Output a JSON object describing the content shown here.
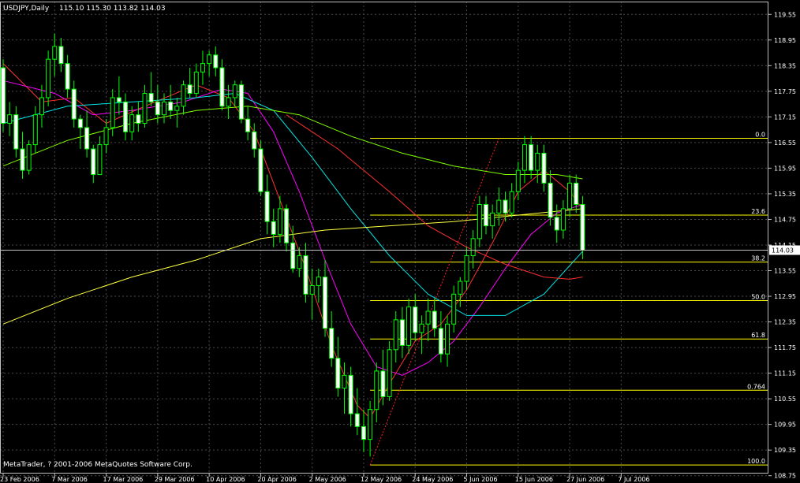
{
  "window": {
    "title": "USDJPY,Daily",
    "ohlc": "115.10 115.30 113.82 114.03"
  },
  "footer": {
    "copyright": "MetaTrader, ? 2001-2006 MetaQuotes Software Corp."
  },
  "colors": {
    "background": "#000000",
    "grid": "#4a4a4a",
    "axis": "#c0c0c0",
    "bull": "#00ff00",
    "bear_body": "#ffffff",
    "bear_outline": "#00ff00",
    "fib": "#ffff00",
    "bid_line": "#c0c0c0",
    "ma_red": "#ff3030",
    "ma_magenta": "#ff00ff",
    "ma_cyan": "#00e5e5",
    "ma_green": "#80ff00",
    "ma_yellow": "#ffff40"
  },
  "chart_data": {
    "type": "candlestick",
    "symbol": "USDJPY",
    "timeframe": "Daily",
    "y_range": [
      108.8,
      119.85
    ],
    "y_ticks": [
      "119.55",
      "118.95",
      "118.35",
      "117.75",
      "117.15",
      "116.55",
      "115.95",
      "115.35",
      "114.75",
      "114.15",
      "113.55",
      "112.95",
      "112.35",
      "111.75",
      "111.15",
      "110.55",
      "109.95",
      "109.35",
      "108.75"
    ],
    "x_labels": [
      {
        "label": "23 Feb 2006",
        "index": 0
      },
      {
        "label": "7 Mar 2006",
        "index": 8
      },
      {
        "label": "17 Mar 2006",
        "index": 16
      },
      {
        "label": "29 Mar 2006",
        "index": 24
      },
      {
        "label": "10 Apr 2006",
        "index": 32
      },
      {
        "label": "20 Apr 2006",
        "index": 40
      },
      {
        "label": "2 May 2006",
        "index": 48
      },
      {
        "label": "12 May 2006",
        "index": 56
      },
      {
        "label": "24 May 2006",
        "index": 64
      },
      {
        "label": "5 Jun 2006",
        "index": 72
      },
      {
        "label": "15 Jun 2006",
        "index": 80
      },
      {
        "label": "27 Jun 2006",
        "index": 88
      },
      {
        "label": "7 Jul 2006",
        "index": 96
      }
    ],
    "current_price": "114.03",
    "fibonacci": {
      "levels": [
        {
          "label": "0.0",
          "price": 116.65
        },
        {
          "label": "23.6",
          "price": 114.85
        },
        {
          "label": "38.2",
          "price": 113.75
        },
        {
          "label": "50.0",
          "price": 112.85
        },
        {
          "label": "61.8",
          "price": 111.95
        },
        {
          "label": "0.764",
          "price": 110.75
        },
        {
          "label": "100.0",
          "price": 109.0
        }
      ],
      "start_index": 57,
      "end_index": 97
    },
    "fib_trend": {
      "from_index": 57,
      "from_price": 109.0,
      "to_index": 77,
      "to_price": 116.65
    },
    "candles": [
      [
        118.3,
        118.5,
        116.8,
        117.0
      ],
      [
        117.0,
        117.5,
        116.7,
        117.2
      ],
      [
        117.2,
        117.4,
        116.2,
        116.4
      ],
      [
        116.4,
        116.8,
        115.7,
        115.9
      ],
      [
        115.9,
        116.6,
        115.8,
        116.5
      ],
      [
        116.5,
        117.4,
        116.3,
        117.2
      ],
      [
        117.2,
        117.9,
        116.9,
        117.6
      ],
      [
        117.6,
        118.7,
        117.4,
        118.5
      ],
      [
        118.5,
        119.1,
        118.1,
        118.8
      ],
      [
        118.8,
        119.0,
        118.2,
        118.4
      ],
      [
        118.4,
        118.6,
        117.6,
        117.8
      ],
      [
        117.8,
        118.0,
        116.9,
        117.1
      ],
      [
        117.1,
        117.2,
        116.4,
        116.9
      ],
      [
        116.9,
        117.3,
        116.2,
        116.4
      ],
      [
        116.4,
        116.5,
        115.6,
        115.8
      ],
      [
        115.8,
        116.7,
        115.8,
        116.5
      ],
      [
        116.5,
        117.1,
        116.3,
        116.9
      ],
      [
        116.9,
        117.8,
        116.7,
        117.6
      ],
      [
        117.6,
        118.1,
        117.2,
        117.5
      ],
      [
        117.5,
        117.7,
        116.6,
        116.8
      ],
      [
        116.8,
        117.4,
        116.6,
        117.2
      ],
      [
        117.2,
        117.5,
        116.8,
        117.0
      ],
      [
        117.0,
        117.9,
        116.9,
        117.7
      ],
      [
        117.7,
        118.2,
        117.4,
        117.5
      ],
      [
        117.5,
        117.9,
        117.0,
        117.2
      ],
      [
        117.2,
        117.7,
        117.0,
        117.5
      ],
      [
        117.5,
        117.9,
        117.1,
        117.3
      ],
      [
        117.3,
        117.6,
        116.9,
        117.4
      ],
      [
        117.4,
        118.0,
        117.2,
        117.9
      ],
      [
        117.9,
        118.3,
        117.6,
        117.7
      ],
      [
        117.7,
        118.4,
        117.6,
        118.2
      ],
      [
        118.2,
        118.7,
        117.9,
        118.4
      ],
      [
        118.4,
        118.7,
        118.1,
        118.6
      ],
      [
        118.6,
        118.8,
        118.1,
        118.3
      ],
      [
        118.3,
        118.5,
        117.3,
        117.4
      ],
      [
        117.4,
        117.9,
        117.1,
        117.6
      ],
      [
        117.6,
        118.0,
        117.4,
        117.9
      ],
      [
        117.9,
        118.0,
        117.0,
        117.1
      ],
      [
        117.1,
        117.4,
        116.6,
        116.8
      ],
      [
        116.8,
        117.0,
        116.2,
        116.4
      ],
      [
        116.4,
        116.6,
        115.3,
        115.4
      ],
      [
        115.4,
        115.8,
        114.4,
        114.7
      ],
      [
        114.7,
        115.0,
        114.1,
        114.4
      ],
      [
        114.4,
        115.3,
        114.2,
        115.0
      ],
      [
        115.0,
        115.1,
        114.0,
        114.2
      ],
      [
        114.2,
        114.6,
        113.5,
        113.6
      ],
      [
        113.6,
        114.1,
        113.4,
        113.9
      ],
      [
        113.9,
        114.2,
        112.8,
        113.0
      ],
      [
        113.0,
        113.6,
        112.4,
        113.2
      ],
      [
        113.2,
        113.6,
        112.8,
        113.4
      ],
      [
        113.4,
        113.8,
        112.0,
        112.2
      ],
      [
        112.2,
        112.6,
        111.3,
        111.5
      ],
      [
        111.5,
        112.0,
        110.6,
        110.8
      ],
      [
        110.8,
        111.4,
        110.2,
        111.1
      ],
      [
        111.1,
        111.3,
        109.9,
        110.2
      ],
      [
        110.2,
        110.8,
        109.7,
        109.9
      ],
      [
        109.9,
        110.3,
        109.3,
        109.6
      ],
      [
        109.6,
        110.5,
        109.2,
        110.3
      ],
      [
        110.3,
        111.4,
        110.0,
        111.2
      ],
      [
        111.2,
        111.7,
        110.4,
        110.6
      ],
      [
        110.6,
        111.9,
        110.5,
        111.7
      ],
      [
        111.7,
        112.6,
        111.4,
        112.4
      ],
      [
        112.4,
        112.7,
        111.5,
        111.8
      ],
      [
        111.8,
        112.9,
        111.6,
        112.7
      ],
      [
        112.7,
        113.0,
        111.9,
        112.1
      ],
      [
        112.1,
        112.5,
        111.6,
        112.3
      ],
      [
        112.3,
        112.9,
        111.9,
        112.6
      ],
      [
        112.6,
        112.9,
        112.0,
        112.2
      ],
      [
        112.2,
        112.6,
        111.4,
        111.6
      ],
      [
        111.6,
        112.5,
        111.3,
        112.3
      ],
      [
        112.3,
        113.2,
        112.1,
        113.0
      ],
      [
        113.0,
        113.4,
        112.7,
        113.3
      ],
      [
        113.3,
        114.1,
        113.1,
        113.9
      ],
      [
        113.9,
        114.5,
        113.6,
        114.3
      ],
      [
        114.3,
        115.3,
        114.1,
        115.1
      ],
      [
        115.1,
        115.3,
        114.4,
        114.6
      ],
      [
        114.6,
        115.1,
        114.3,
        114.9
      ],
      [
        114.9,
        115.5,
        114.6,
        115.2
      ],
      [
        115.2,
        115.4,
        114.7,
        114.9
      ],
      [
        114.9,
        115.6,
        114.8,
        115.4
      ],
      [
        115.4,
        116.1,
        115.2,
        115.9
      ],
      [
        115.9,
        116.7,
        115.6,
        116.5
      ],
      [
        116.5,
        116.7,
        115.7,
        115.9
      ],
      [
        115.9,
        116.5,
        115.6,
        116.3
      ],
      [
        116.3,
        116.5,
        115.4,
        115.6
      ],
      [
        115.6,
        115.9,
        114.6,
        114.8
      ],
      [
        114.8,
        115.1,
        114.2,
        114.5
      ],
      [
        114.5,
        115.2,
        114.3,
        115.0
      ],
      [
        115.0,
        115.8,
        114.8,
        115.6
      ],
      [
        115.6,
        115.8,
        114.9,
        115.1
      ],
      [
        115.1,
        115.3,
        113.82,
        114.03
      ]
    ],
    "indicators": [
      {
        "color_key": "ma_red",
        "points": [
          [
            0,
            118.4
          ],
          [
            6,
            117.5
          ],
          [
            11,
            117.6
          ],
          [
            16,
            117.0
          ],
          [
            22,
            117.4
          ],
          [
            30,
            117.9
          ],
          [
            35,
            117.6
          ],
          [
            39,
            116.8
          ],
          [
            43,
            115.2
          ],
          [
            47,
            113.6
          ],
          [
            51,
            111.8
          ],
          [
            55,
            110.4
          ],
          [
            57,
            110.1
          ],
          [
            60,
            110.9
          ],
          [
            64,
            111.9
          ],
          [
            68,
            112.3
          ],
          [
            72,
            113.1
          ],
          [
            76,
            114.2
          ],
          [
            80,
            115.4
          ],
          [
            84,
            115.9
          ],
          [
            88,
            115.4
          ],
          [
            90,
            115.0
          ]
        ]
      },
      {
        "color_key": "ma_magenta",
        "points": [
          [
            0,
            118.0
          ],
          [
            8,
            117.7
          ],
          [
            14,
            117.2
          ],
          [
            20,
            117.3
          ],
          [
            28,
            117.5
          ],
          [
            34,
            117.8
          ],
          [
            38,
            117.7
          ],
          [
            42,
            116.8
          ],
          [
            46,
            115.4
          ],
          [
            50,
            113.8
          ],
          [
            54,
            112.3
          ],
          [
            58,
            111.3
          ],
          [
            62,
            111.1
          ],
          [
            66,
            111.4
          ],
          [
            70,
            111.9
          ],
          [
            74,
            112.7
          ],
          [
            78,
            113.6
          ],
          [
            82,
            114.4
          ],
          [
            86,
            114.9
          ],
          [
            90,
            115.1
          ]
        ]
      },
      {
        "color_key": "ma_cyan",
        "points": [
          [
            0,
            117.0
          ],
          [
            10,
            117.4
          ],
          [
            20,
            117.5
          ],
          [
            30,
            117.6
          ],
          [
            36,
            117.7
          ],
          [
            42,
            117.3
          ],
          [
            48,
            116.2
          ],
          [
            54,
            115.0
          ],
          [
            60,
            113.9
          ],
          [
            66,
            113.0
          ],
          [
            72,
            112.5
          ],
          [
            78,
            112.5
          ],
          [
            84,
            113.0
          ],
          [
            90,
            114.0
          ]
        ]
      },
      {
        "color_key": "ma_green",
        "points": [
          [
            0,
            116.0
          ],
          [
            10,
            116.6
          ],
          [
            20,
            117.0
          ],
          [
            30,
            117.3
          ],
          [
            38,
            117.4
          ],
          [
            46,
            117.2
          ],
          [
            54,
            116.7
          ],
          [
            62,
            116.3
          ],
          [
            70,
            116.0
          ],
          [
            78,
            115.8
          ],
          [
            86,
            115.8
          ],
          [
            90,
            115.7
          ]
        ]
      },
      {
        "color_key": "ma_yellow",
        "points": [
          [
            0,
            112.3
          ],
          [
            10,
            112.9
          ],
          [
            20,
            113.4
          ],
          [
            30,
            113.8
          ],
          [
            40,
            114.3
          ],
          [
            50,
            114.5
          ],
          [
            60,
            114.6
          ],
          [
            70,
            114.7
          ],
          [
            80,
            114.85
          ],
          [
            90,
            115.0
          ]
        ]
      },
      {
        "color_key": "ma_red",
        "points": [
          [
            44,
            117.2
          ],
          [
            52,
            116.4
          ],
          [
            60,
            115.4
          ],
          [
            66,
            114.6
          ],
          [
            72,
            114.1
          ],
          [
            78,
            113.7
          ],
          [
            84,
            113.4
          ],
          [
            88,
            113.35
          ],
          [
            90,
            113.4
          ]
        ]
      }
    ]
  }
}
